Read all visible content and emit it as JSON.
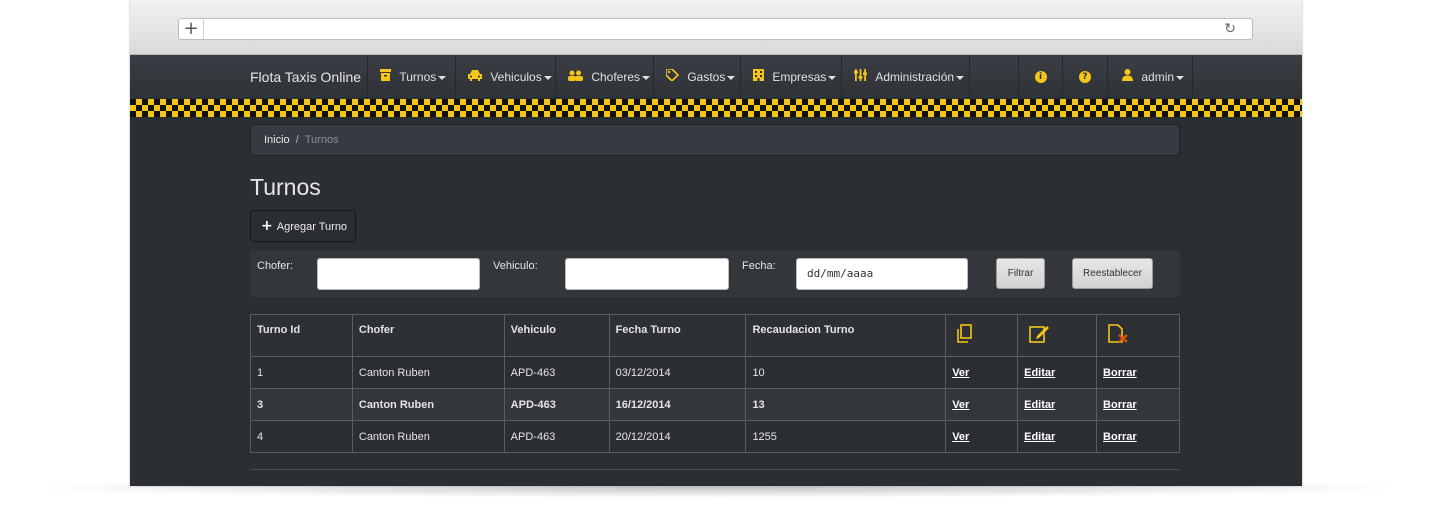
{
  "browser": {
    "new_tab_symbol": "+",
    "reload_symbol": "↻"
  },
  "navbar": {
    "brand": "Flota Taxis Online",
    "items": [
      {
        "label": "Turnos",
        "icon": "archive-icon"
      },
      {
        "label": "Vehiculos",
        "icon": "car-icon"
      },
      {
        "label": "Choferes",
        "icon": "users-icon"
      },
      {
        "label": "Gastos",
        "icon": "tags-icon"
      },
      {
        "label": "Empresas",
        "icon": "building-icon"
      },
      {
        "label": "Administración",
        "icon": "sliders-icon"
      }
    ],
    "info_glyph": "i",
    "help_glyph": "?",
    "user": "admin",
    "accent": "#f5c518"
  },
  "breadcrumb": {
    "home": "Inicio",
    "separator": "/",
    "current": "Turnos"
  },
  "page": {
    "title": "Turnos",
    "add_button": "Agregar Turno",
    "add_symbol": "+"
  },
  "filters": {
    "chofer_label": "Chofer:",
    "chofer_value": "",
    "vehiculo_label": "Vehiculo:",
    "vehiculo_value": "",
    "fecha_label": "Fecha:",
    "fecha_value": "dd/mm/aaaa",
    "filter_button": "Filtrar",
    "reset_button": "Reestablecer"
  },
  "table": {
    "headers": [
      "Turno Id",
      "Chofer",
      "Vehiculo",
      "Fecha Turno",
      "Recaudacion Turno"
    ],
    "icon_headers": [
      "view-document-icon",
      "edit-document-icon",
      "delete-document-icon"
    ],
    "rows": [
      {
        "id": "1",
        "chofer": "Canton Ruben",
        "vehiculo": "APD-463",
        "fecha": "03/12/2014",
        "recaudacion": "10",
        "ver": "Ver",
        "editar": "Editar",
        "borrar": "Borrar"
      },
      {
        "id": "3",
        "chofer": "Canton Ruben",
        "vehiculo": "APD-463",
        "fecha": "16/12/2014",
        "recaudacion": "13",
        "ver": "Ver",
        "editar": "Editar",
        "borrar": "Borrar"
      },
      {
        "id": "4",
        "chofer": "Canton Ruben",
        "vehiculo": "APD-463",
        "fecha": "20/12/2014",
        "recaudacion": "1255",
        "ver": "Ver",
        "editar": "Editar",
        "borrar": "Borrar"
      }
    ]
  }
}
